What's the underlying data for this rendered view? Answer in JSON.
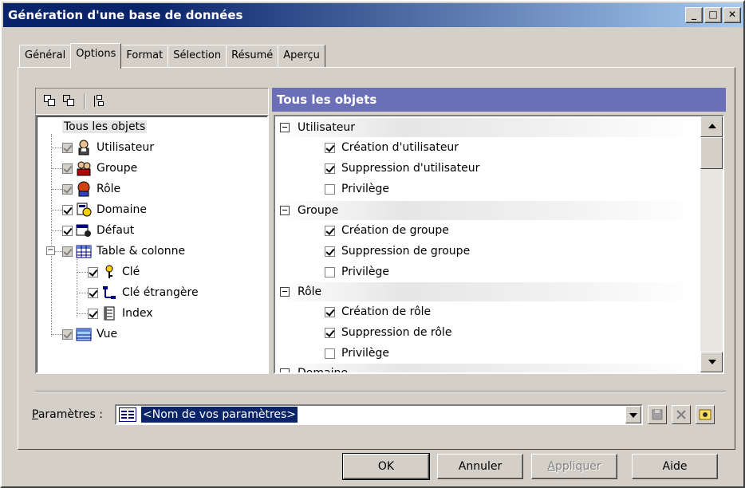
{
  "window": {
    "title": "Génération d'une base de données"
  },
  "titlebar_buttons": [
    "_",
    "□",
    "✕"
  ],
  "tabs": [
    {
      "label": "Général",
      "active": false
    },
    {
      "label": "Options",
      "active": true
    },
    {
      "label": "Format",
      "active": false
    },
    {
      "label": "Sélection",
      "active": false
    },
    {
      "label": "Résumé",
      "active": false
    },
    {
      "label": "Aperçu",
      "active": false
    }
  ],
  "tree": {
    "root": "Tous les objets",
    "items": [
      {
        "label": "Utilisateur",
        "icon": "user-icon",
        "checked": true,
        "grayed": true
      },
      {
        "label": "Groupe",
        "icon": "group-icon",
        "checked": true,
        "grayed": true
      },
      {
        "label": "Rôle",
        "icon": "role-icon",
        "checked": true,
        "grayed": true
      },
      {
        "label": "Domaine",
        "icon": "domain-icon",
        "checked": true,
        "grayed": false
      },
      {
        "label": "Défaut",
        "icon": "default-icon",
        "checked": true,
        "grayed": false
      },
      {
        "label": "Table & colonne",
        "icon": "table-icon",
        "checked": true,
        "grayed": true
      },
      {
        "label": "Clé",
        "icon": "key-icon",
        "checked": true,
        "grayed": false
      },
      {
        "label": "Clé étrangère",
        "icon": "foreign-key-icon",
        "checked": true,
        "grayed": false
      },
      {
        "label": "Index",
        "icon": "index-icon",
        "checked": true,
        "grayed": false
      },
      {
        "label": "Vue",
        "icon": "view-icon",
        "checked": true,
        "grayed": true
      }
    ]
  },
  "right_panel": {
    "header": "Tous les objets",
    "groups": [
      {
        "label": "Utilisateur",
        "options": [
          {
            "label": "Création d'utilisateur",
            "checked": true
          },
          {
            "label": "Suppression d'utilisateur",
            "checked": true
          },
          {
            "label": "Privilège",
            "checked": false
          }
        ]
      },
      {
        "label": "Groupe",
        "options": [
          {
            "label": "Création de groupe",
            "checked": true
          },
          {
            "label": "Suppression de groupe",
            "checked": true
          },
          {
            "label": "Privilège",
            "checked": false
          }
        ]
      },
      {
        "label": "Rôle",
        "options": [
          {
            "label": "Création de rôle",
            "checked": true
          },
          {
            "label": "Suppression de rôle",
            "checked": true
          },
          {
            "label": "Privilège",
            "checked": false
          }
        ]
      },
      {
        "label": "Domaine",
        "options": []
      }
    ]
  },
  "parameters": {
    "label": "Paramètres :",
    "value": "<Nom de vos paramètres>"
  },
  "buttons": {
    "ok": "OK",
    "cancel": "Annuler",
    "apply": "Appliquer",
    "help": "Aide"
  },
  "colors": {
    "title_gradient_start": "#0a246a",
    "title_gradient_end": "#a6caf0",
    "header_bg": "#6b6fb7",
    "face": "#d4d0c8"
  }
}
